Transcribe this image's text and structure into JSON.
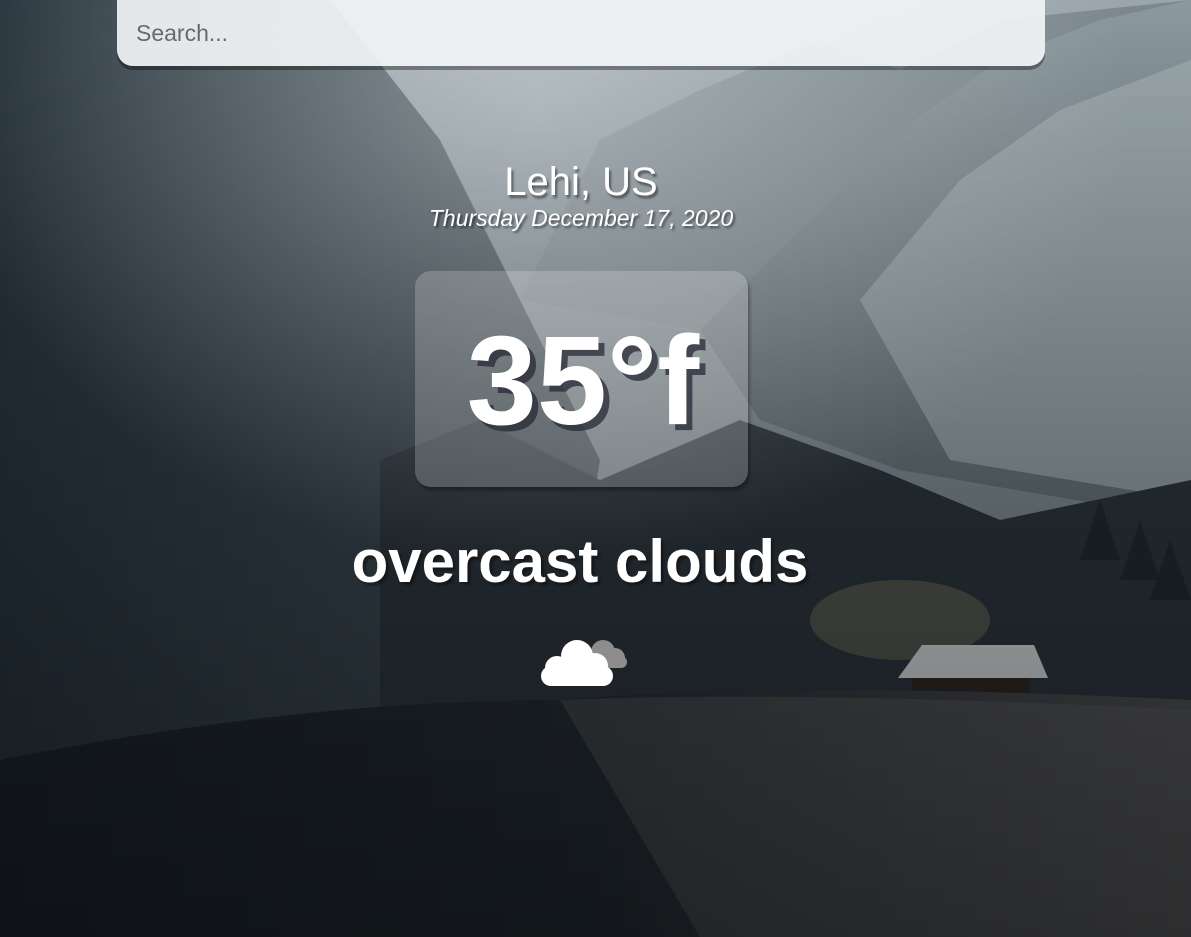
{
  "search": {
    "placeholder": "Search..."
  },
  "location": "Lehi, US",
  "date": "Thursday December 17, 2020",
  "temperature": "35°f",
  "weather_description": "overcast clouds",
  "weather_icon": "overcast-cloud-icon",
  "colors": {
    "text": "#ffffff",
    "search_bg": "#f0f3f5",
    "scene_dark": "#1d242b"
  }
}
